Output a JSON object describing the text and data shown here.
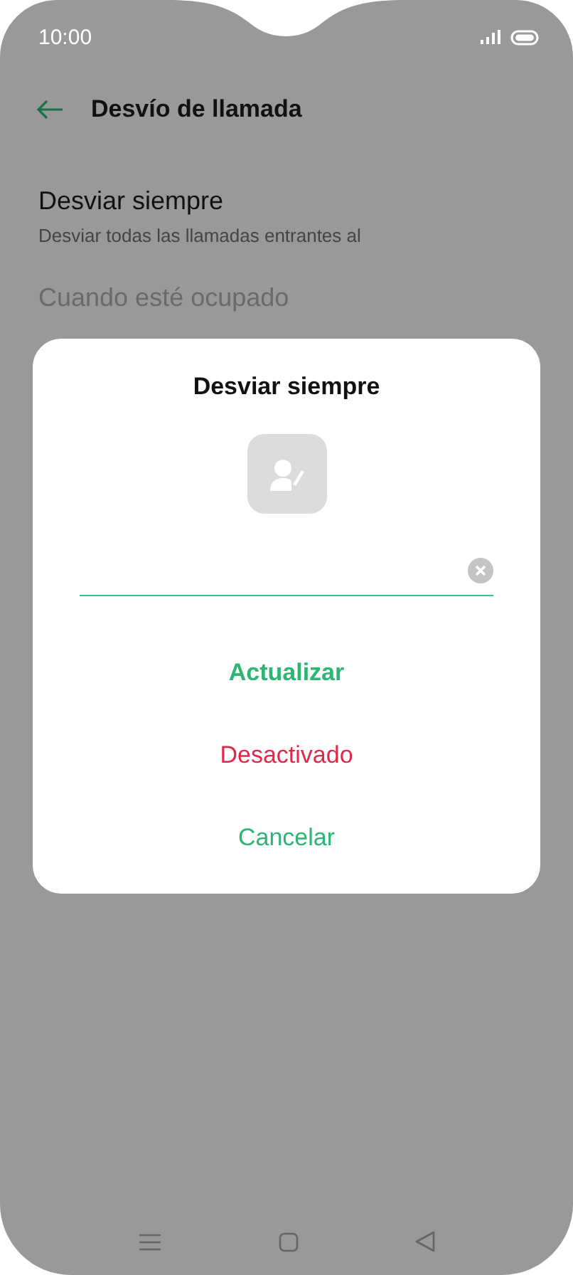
{
  "status_bar": {
    "time": "10:00"
  },
  "header": {
    "title": "Desvío de llamada"
  },
  "settings": [
    {
      "title": "Desviar siempre",
      "subtitle": "Desviar todas las llamadas entrantes al",
      "disabled": false
    },
    {
      "title": "Cuando esté ocupado",
      "disabled": true
    }
  ],
  "dialog": {
    "title": "Desviar siempre",
    "actions": [
      {
        "label": "Actualizar",
        "kind": "primary"
      },
      {
        "label": "Desactivado",
        "kind": "danger"
      },
      {
        "label": "Cancelar",
        "kind": "normal"
      }
    ]
  }
}
